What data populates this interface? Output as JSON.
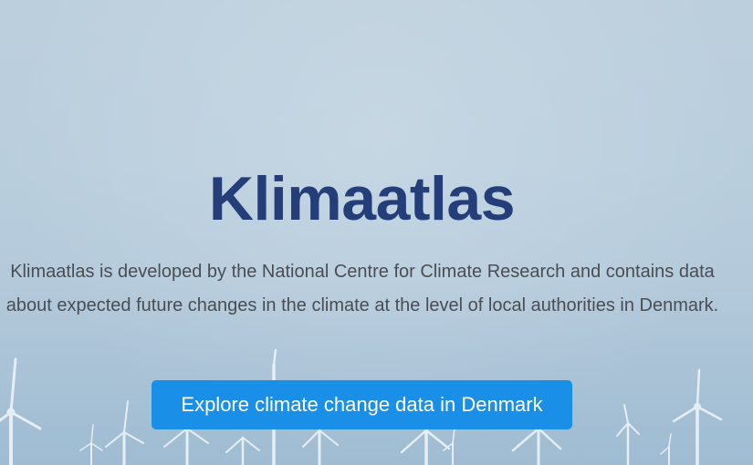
{
  "hero": {
    "title": "Klimaatlas",
    "description": "Klimaatlas is developed by the National Centre for Climate Research and contains data about expected future changes in the climate at the level of local authorities in Denmark.",
    "cta_label": "Explore climate change data in Denmark",
    "background_image": "offshore-wind-turbines"
  },
  "colors": {
    "title": "#233e78",
    "text": "#4a4d52",
    "button": "#1a8fe8",
    "button_text": "#ffffff",
    "sky": "#bccfdd"
  }
}
